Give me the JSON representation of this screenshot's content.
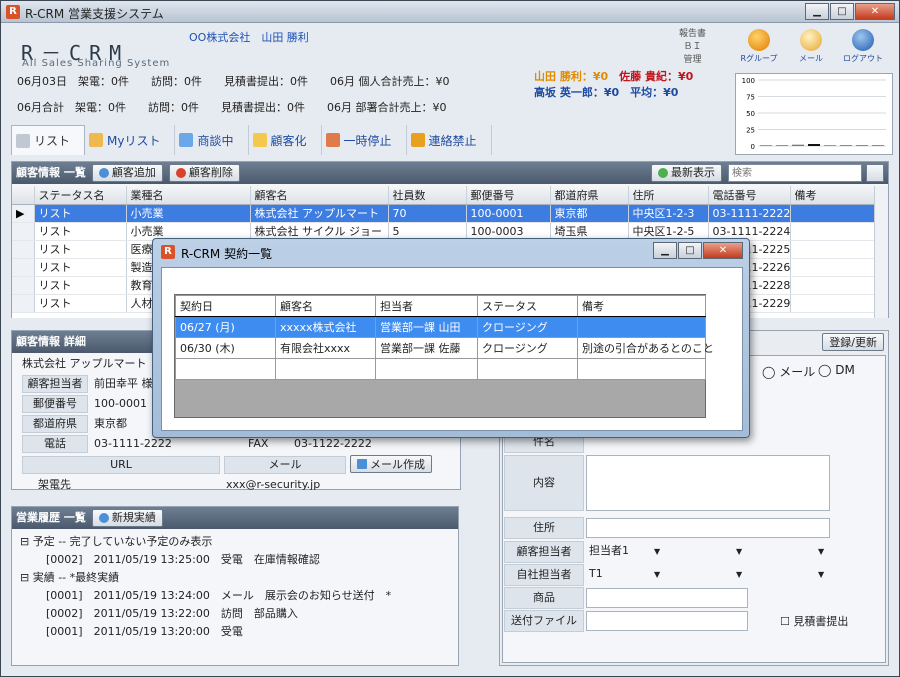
{
  "window": {
    "title": "R-CRM 営業支援システム",
    "app_icon": "R"
  },
  "header": {
    "logo": "R－CRM",
    "logo_sub": "All Sales Sharing System",
    "company": "OO株式会社　山田 勝利",
    "links": [
      "報告書",
      "ＢＩ",
      "管理"
    ],
    "icons": [
      {
        "label": "Rグループ",
        "icon": "rgroup-icon"
      },
      {
        "label": "メール",
        "icon": "mail-icon"
      },
      {
        "label": "ログアウト",
        "icon": "logout-icon"
      }
    ]
  },
  "stats": {
    "row1": [
      "06月03日",
      "架電：0件",
      "訪問：0件",
      "見積書提出：0件",
      "06月 個人合計売上：¥0"
    ],
    "row2": [
      "06月合計",
      "架電：0件",
      "訪問：0件",
      "見積書提出：0件",
      "06月 部署合計売上：¥0"
    ]
  },
  "ranking": {
    "r1a": "山田 勝利：¥0",
    "r1b": "佐藤 貴紀：¥0",
    "r2a": "高坂 英一郎：¥0",
    "r2b": "平均：¥0"
  },
  "minichart": {
    "chart_data": {
      "type": "bar",
      "yticks": [
        "100",
        "75",
        "50",
        "25",
        "0"
      ],
      "ylim": [
        0,
        100
      ],
      "values": [
        1,
        1,
        2,
        3,
        1,
        1,
        1,
        1
      ]
    }
  },
  "tabs": [
    "リスト",
    "Myリスト",
    "商談中",
    "顧客化",
    "一時停止",
    "連絡禁止"
  ],
  "customer_list": {
    "title": "顧客情報 一覧",
    "add_btn": "顧客追加",
    "del_btn": "顧客削除",
    "refresh_btn": "最新表示",
    "search_placeholder": "検索",
    "columns": [
      "ステータス名",
      "業種名",
      "顧客名",
      "社員数",
      "郵便番号",
      "都道府県",
      "住所",
      "電話番号",
      "備考"
    ],
    "rows": [
      [
        "リスト",
        "小売業",
        "株式会社 アップルマート",
        "70",
        "100-0001",
        "東京都",
        "中央区1-2-3",
        "03-1111-2222",
        ""
      ],
      [
        "リスト",
        "小売業",
        "株式会社 サイクル ジョー",
        "5",
        "100-0003",
        "埼玉県",
        "中央区1-2-5",
        "03-1111-2224",
        ""
      ],
      [
        "リスト",
        "医療",
        "",
        "",
        "",
        "",
        "",
        "03-1111-2225",
        ""
      ],
      [
        "リスト",
        "製造",
        "",
        "",
        "",
        "",
        "",
        "03-1111-2226",
        ""
      ],
      [
        "リスト",
        "教育",
        "",
        "",
        "",
        "",
        "",
        "03-1111-2228",
        ""
      ],
      [
        "リスト",
        "人材",
        "",
        "",
        "",
        "",
        "",
        "03-1111-2229",
        ""
      ]
    ]
  },
  "customer_detail": {
    "title": "顧客情報 詳細",
    "name": "株式会社 アップルマート",
    "fields": [
      {
        "label": "顧客担当者",
        "value": "前田幸平 様"
      },
      {
        "label": "郵便番号",
        "value": "100-0001"
      },
      {
        "label": "都道府県",
        "value": "東京都"
      },
      {
        "label": "電話",
        "value": "03-1111-2222"
      }
    ],
    "fax_label": "FAX",
    "fax_value": "03-1122-2222",
    "url_label": "URL",
    "mail_label": "メール",
    "mail_btn": "メール作成",
    "partner_label": "架電先",
    "mail_value": "xxx@r-security.jp"
  },
  "history": {
    "title": "営業履歴 一覧",
    "new_btn": "新規実績",
    "lines": [
      "予定 -- 完了していない予定のみ表示",
      "[0002]　2011/05/19 13:25:00　受電　在庫情報確認",
      "実績 -- *最終実績",
      "[0001]　2011/05/19 13:24:00　メール　展示会のお知らせ送付　*",
      "[0002]　2011/05/19 13:22:00　訪問　部品購入",
      "[0001]　2011/05/19 13:20:00　受電"
    ]
  },
  "right_panel": {
    "save_btn": "登録/更新",
    "radio_mail": "メール",
    "radio_dm": "DM",
    "subject_label": "件名",
    "content_label": "内容",
    "address_label": "住所",
    "cust_rep_label": "顧客担当者",
    "cust_rep_value": "担当者1",
    "own_rep_label": "自社担当者",
    "own_rep_value": "T1",
    "product_label": "商品",
    "file_label": "送付ファイル",
    "estimate_label": "見積書提出"
  },
  "modal": {
    "title": "R-CRM 契約一覧",
    "columns": [
      "契約日",
      "顧客名",
      "担当者",
      "ステータス",
      "備考"
    ],
    "rows": [
      [
        "06/27 (月)",
        "xxxxx株式会社",
        "営業部一課 山田",
        "クロージング",
        ""
      ],
      [
        "06/30 (木)",
        "有限会社xxxx",
        "営業部一課 佐藤",
        "クロージング",
        "別途の引合があるとのこと"
      ],
      [
        "",
        "",
        "",
        "",
        ""
      ]
    ]
  }
}
